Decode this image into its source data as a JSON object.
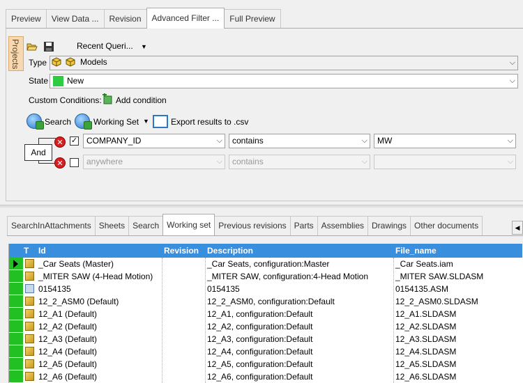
{
  "top_tabs": [
    "Preview",
    "View Data ...",
    "Revision",
    "Advanced Filter ...",
    "Full Preview"
  ],
  "top_active": "Advanced Filter ...",
  "sidebar": {
    "projects_label": "Projects"
  },
  "toolbar": {
    "open_icon": "folder-open-icon",
    "save_icon": "save-icon",
    "recent_queries_label": "Recent Queri..."
  },
  "type": {
    "label": "Type",
    "value": "Models",
    "icon": "models-icon"
  },
  "state": {
    "label": "State",
    "value": "New",
    "color": "#2ecc40"
  },
  "custom_conditions": {
    "label": "Custom Conditions:",
    "add_label": "Add condition"
  },
  "actions": {
    "search_label": "Search",
    "working_set_label": "Working Set",
    "export_label": "Export results to .csv"
  },
  "conditions": [
    {
      "logic": "And",
      "checked": true,
      "field": "COMPANY_ID",
      "operator": "contains",
      "value": "MW",
      "enabled": true
    },
    {
      "checked": false,
      "field": "anywhere",
      "operator": "contains",
      "value": "",
      "enabled": false
    }
  ],
  "bottom_tabs": [
    "SearchInAttachments",
    "Sheets",
    "Search",
    "Working set",
    "Previous revisions",
    "Parts",
    "Assemblies",
    "Drawings",
    "Other documents"
  ],
  "bottom_active": "Working set",
  "grid": {
    "headers": {
      "t": "T",
      "id": "Id",
      "revision": "Revision",
      "description": "Description",
      "file_name": "File_name"
    },
    "rows": [
      {
        "id": "_Car Seats (Master)",
        "revision": "",
        "description": "_Car Seats, configuration:Master",
        "file_name": "_Car Seats.iam",
        "type": "assembly-inventor"
      },
      {
        "id": "_MITER SAW (4-Head Motion)",
        "revision": "",
        "description": "_MITER SAW, configuration:4-Head Motion",
        "file_name": "_MITER SAW.SLDASM",
        "type": "assembly"
      },
      {
        "id": "0154135",
        "revision": "",
        "description": "0154135",
        "file_name": "0154135.ASM",
        "type": "part"
      },
      {
        "id": "12_2_ASM0 (Default)",
        "revision": "",
        "description": "12_2_ASM0, configuration:Default",
        "file_name": "12_2_ASM0.SLDASM",
        "type": "assembly"
      },
      {
        "id": "12_A1 (Default)",
        "revision": "",
        "description": "12_A1, configuration:Default",
        "file_name": "12_A1.SLDASM",
        "type": "assembly"
      },
      {
        "id": "12_A2 (Default)",
        "revision": "",
        "description": "12_A2, configuration:Default",
        "file_name": "12_A2.SLDASM",
        "type": "assembly"
      },
      {
        "id": "12_A3 (Default)",
        "revision": "",
        "description": "12_A3, configuration:Default",
        "file_name": "12_A3.SLDASM",
        "type": "assembly"
      },
      {
        "id": "12_A4 (Default)",
        "revision": "",
        "description": "12_A4, configuration:Default",
        "file_name": "12_A4.SLDASM",
        "type": "assembly"
      },
      {
        "id": "12_A5 (Default)",
        "revision": "",
        "description": "12_A5, configuration:Default",
        "file_name": "12_A5.SLDASM",
        "type": "assembly"
      },
      {
        "id": "12_A6 (Default)",
        "revision": "",
        "description": "12_A6, configuration:Default",
        "file_name": "12_A6.SLDASM",
        "type": "assembly"
      }
    ]
  },
  "colors": {
    "header_blue": "#3a8ede",
    "status_green": "#22c022"
  }
}
